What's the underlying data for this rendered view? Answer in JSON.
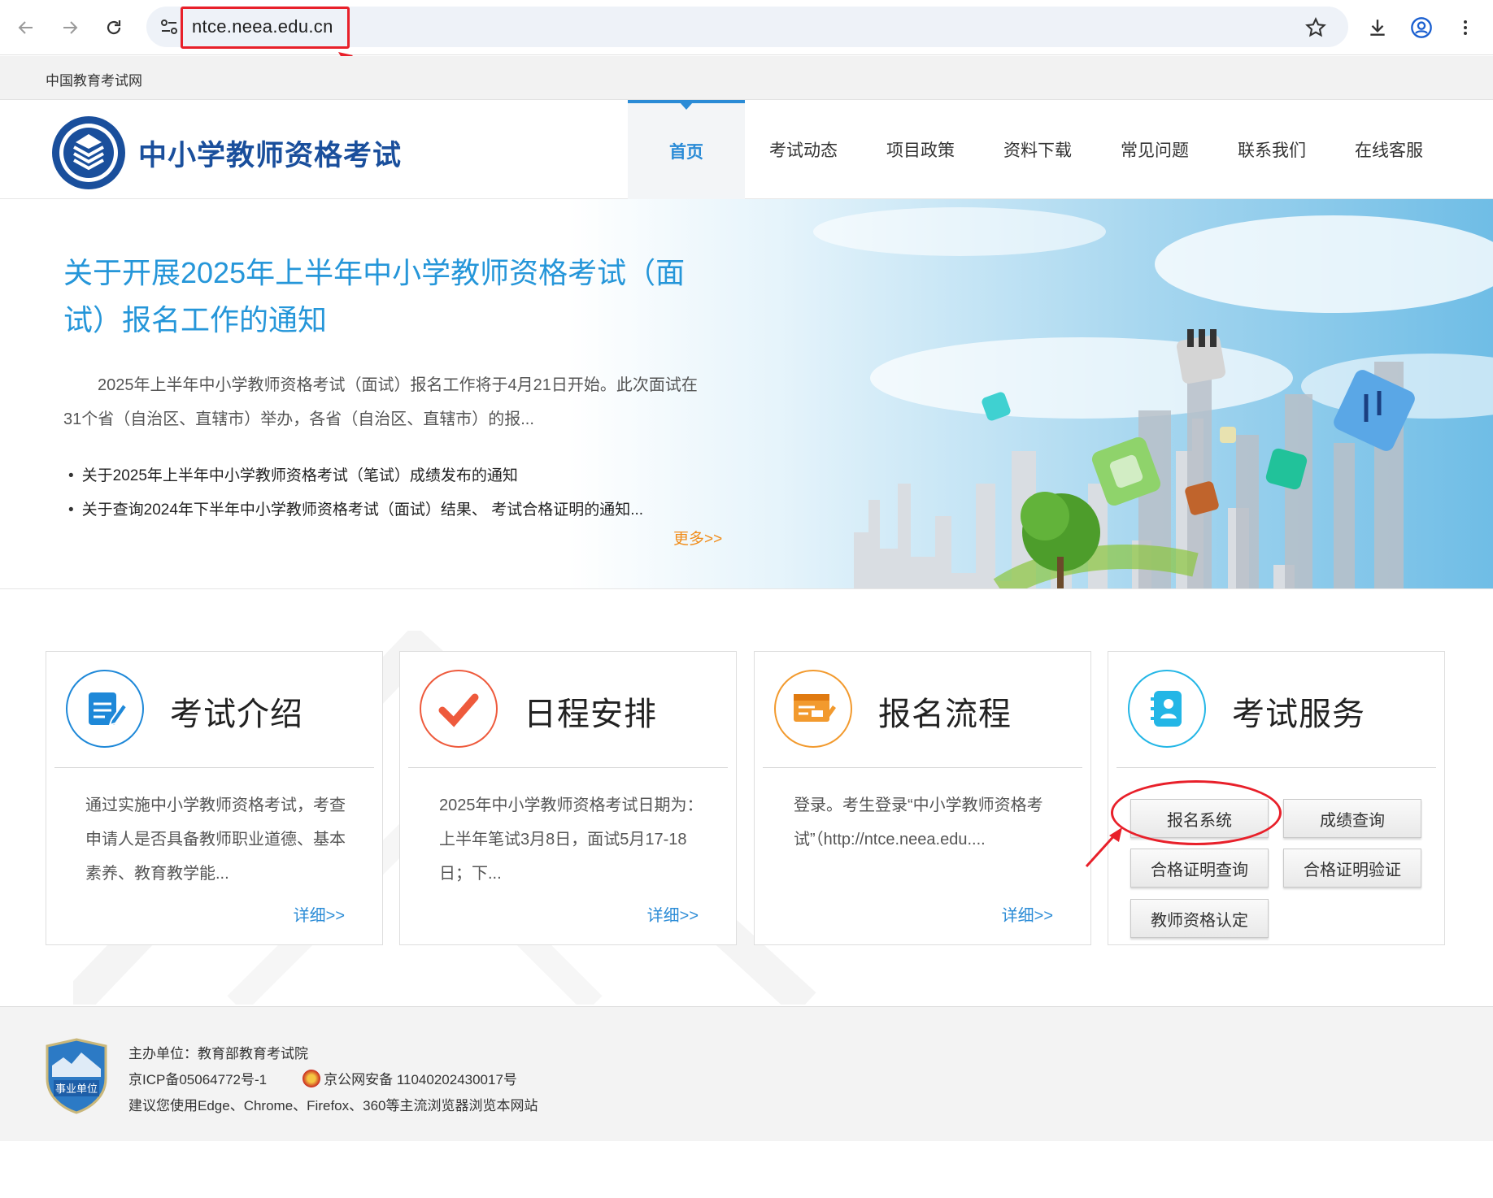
{
  "browser": {
    "url": "ntce.neea.edu.cn"
  },
  "topbar": {
    "site_name": "中国教育考试网"
  },
  "header": {
    "title": "中小学教师资格考试",
    "nav": [
      {
        "label": "首页"
      },
      {
        "label": "考试动态"
      },
      {
        "label": "项目政策"
      },
      {
        "label": "资料下载"
      },
      {
        "label": "常见问题"
      },
      {
        "label": "联系我们"
      },
      {
        "label": "在线客服"
      }
    ]
  },
  "banner": {
    "title": "关于开展2025年上半年中小学教师资格考试（面试）报名工作的通知",
    "description": "2025年上半年中小学教师资格考试（面试）报名工作将于4月21日开始。此次面试在31个省（自治区、直辖市）举办，各省（自治区、直辖市）的报...",
    "news": [
      "关于2025年上半年中小学教师资格考试（笔试）成绩发布的通知",
      "关于查询2024年下半年中小学教师资格考试（面试）结果、 考试合格证明的通知..."
    ],
    "more": "更多>>"
  },
  "cards": [
    {
      "title": "考试介绍",
      "desc": "通过实施中小学教师资格考试，考查申请人是否具备教师职业道德、基本素养、教育教学能...",
      "more": "详细>>",
      "icon_color": "#1e88d8"
    },
    {
      "title": "日程安排",
      "desc": "2025年中小学教师资格考试日期为：上半年笔试3月8日，面试5月17-18日；下...",
      "more": "详细>>",
      "icon_color": "#ee5a3c"
    },
    {
      "title": "报名流程",
      "desc": "登录。考生登录“中小学教师资格考试”（http://ntce.neea.edu....",
      "more": "详细>>",
      "icon_color": "#f29a2e"
    },
    {
      "title": "考试服务",
      "icon_color": "#23b6e6",
      "buttons": [
        "报名系统",
        "成绩查询",
        "合格证明查询",
        "合格证明验证",
        "教师资格认定"
      ]
    }
  ],
  "footer": {
    "sponsor": "主办单位：教育部教育考试院",
    "icp": "京ICP备05064772号-1",
    "police": "京公网安备 11040202430017号",
    "browser_tip": "建议您使用Edge、Chrome、Firefox、360等主流浏览器浏览本网站",
    "badge_text": "事业单位"
  }
}
